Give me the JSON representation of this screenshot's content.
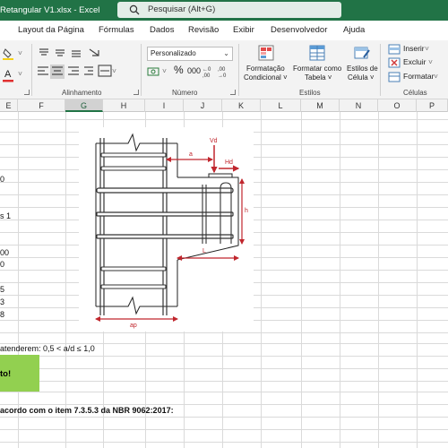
{
  "titlebar": {
    "title": "Retangular V1.xlsx  -  Excel",
    "search_placeholder": "Pesquisar (Alt+G)"
  },
  "tabs": [
    "Layout da Página",
    "Fórmulas",
    "Dados",
    "Revisão",
    "Exibir",
    "Desenvolvedor",
    "Ajuda"
  ],
  "ribbon": {
    "number_format": "Personalizado",
    "groups": {
      "alignment": "Alinhamento",
      "number": "Número",
      "styles": "Estilos",
      "cells": "Células"
    },
    "styles_buttons": {
      "conditional_1": "Formatação",
      "conditional_2": "Condicional ˅",
      "table_1": "Formatar como",
      "table_2": "Tabela ˅",
      "cell_1": "Estilos de",
      "cell_2": "Célula ˅"
    },
    "cells_commands": {
      "insert": "Inserir",
      "delete": "Excluir",
      "format": "Formatar"
    },
    "percent": "%",
    "thousands": "000"
  },
  "columns": [
    "E",
    "F",
    "G",
    "H",
    "I",
    "J",
    "K",
    "L",
    "M",
    "N",
    "O",
    "P"
  ],
  "selected_column": "G",
  "cells": {
    "r1": "0",
    "r2": "s 1",
    "r3": "00",
    "r4": "0",
    "r5": "5",
    "r6": "3",
    "r7": "8",
    "condition": "atenderem: 0,5 < a/d ≤ 1,0",
    "result": "to!",
    "norm": "acordo com o item 7.3.5.3 da NBR 9062:2017:"
  },
  "figure_labels": {
    "vd": "Vd",
    "hd": "Hd",
    "a": "a",
    "h": "h",
    "l": "L",
    "ap": "ap"
  },
  "colors": {
    "excel_green": "#217346",
    "result_fill": "#92d050",
    "dimension_red": "#c0262d"
  }
}
